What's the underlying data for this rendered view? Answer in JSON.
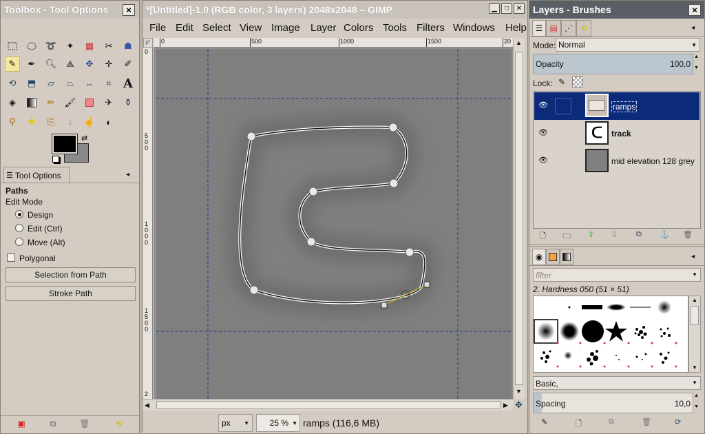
{
  "toolbox": {
    "title": "Toolbox - Tool Options",
    "close": "×",
    "tool_options_tab": "Tool Options",
    "section": "Paths",
    "edit_mode_label": "Edit Mode",
    "modes": [
      "Design",
      "Edit (Ctrl)",
      "Move (Alt)"
    ],
    "selected_mode": "Design",
    "polygonal_label": "Polygonal",
    "selection_button": "Selection from Path",
    "stroke_button": "Stroke Path",
    "colors": {
      "foreground": "#000000",
      "background": "#8a8a8a"
    }
  },
  "image_window": {
    "title": "*[Untitled]-1.0 (RGB color, 3 layers) 2048x2048 – GIMP",
    "menu": [
      "File",
      "Edit",
      "Select",
      "View",
      "Image",
      "Layer",
      "Colors",
      "Tools",
      "Filters",
      "Windows",
      "Help"
    ],
    "ruler_h": [
      "0",
      "500",
      "1000",
      "1500",
      "20"
    ],
    "ruler_v": [
      "0",
      "5\n0\n0",
      "1\n0\n0\n0",
      "1\n5\n0\n0",
      "2"
    ],
    "unit": "px",
    "zoom": "25 %",
    "status": "ramps (116,6 MB)",
    "canvas_color": "#7f7f7f"
  },
  "layers": {
    "title": "Layers - Brushes",
    "close": "×",
    "mode_label": "Mode:",
    "mode_value": "Normal",
    "opacity_label": "Opacity",
    "opacity_value": "100,0",
    "opacity_fraction": 1.0,
    "lock_label": "Lock:",
    "items": [
      {
        "name": "ramps",
        "selected": true,
        "bold": false
      },
      {
        "name": "track",
        "selected": false,
        "bold": true
      },
      {
        "name": "mid elevation 128 grey",
        "selected": false,
        "bold": false
      }
    ]
  },
  "brushes": {
    "filter_placeholder": "filter",
    "current": "2. Hardness 050 (51 × 51)",
    "preset": "Basic,",
    "spacing_label": "Spacing",
    "spacing_value": "10,0",
    "spacing_fraction": 0.05
  }
}
